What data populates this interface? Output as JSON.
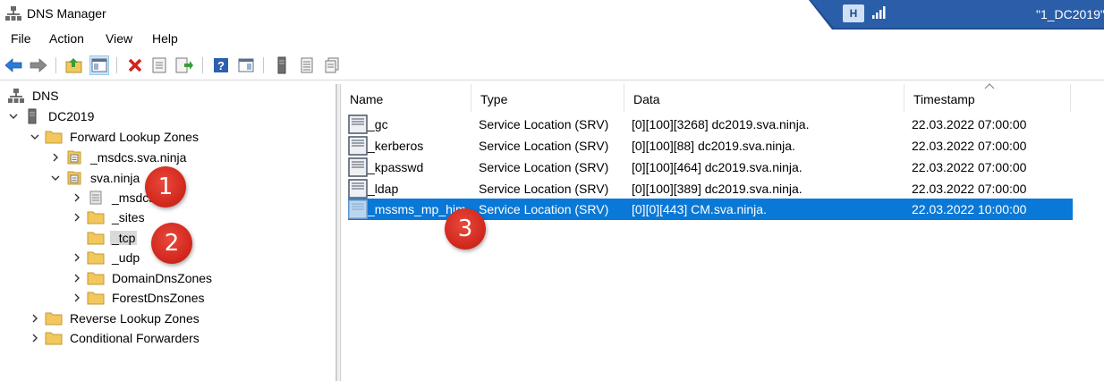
{
  "window": {
    "title": "DNS Manager",
    "remote_session_title": "\"1_DC2019\""
  },
  "menu": [
    "File",
    "Action",
    "View",
    "Help"
  ],
  "toolbar": {
    "buttons": [
      "back-arrow-icon",
      "forward-arrow-icon",
      "up-folder-icon",
      "show-tree-icon",
      "delete-icon",
      "properties-icon",
      "export-icon",
      "help-icon",
      "console-icon",
      "server-icon",
      "list-icon",
      "copy-icon"
    ]
  },
  "tree": {
    "root": "DNS",
    "server": "DC2019",
    "forward_zones": "Forward Lookup Zones",
    "msdcs_zone": "_msdcs.sva.ninja",
    "sva_zone": "sva.ninja",
    "msdcs_sub": "_msdcs",
    "sites": "_sites",
    "tcp": "_tcp",
    "udp": "_udp",
    "domain_dns_zones": "DomainDnsZones",
    "forest_dns_zones": "ForestDnsZones",
    "reverse_zones": "Reverse Lookup Zones",
    "conditional_forwarders": "Conditional Forwarders"
  },
  "list": {
    "columns": [
      "Name",
      "Type",
      "Data",
      "Timestamp"
    ],
    "rows": [
      {
        "name": "_gc",
        "type": "Service Location (SRV)",
        "data": "[0][100][3268] dc2019.sva.ninja.",
        "timestamp": "22.03.2022 07:00:00"
      },
      {
        "name": "_kerberos",
        "type": "Service Location (SRV)",
        "data": "[0][100][88] dc2019.sva.ninja.",
        "timestamp": "22.03.2022 07:00:00"
      },
      {
        "name": "_kpasswd",
        "type": "Service Location (SRV)",
        "data": "[0][100][464] dc2019.sva.ninja.",
        "timestamp": "22.03.2022 07:00:00"
      },
      {
        "name": "_ldap",
        "type": "Service Location (SRV)",
        "data": "[0][100][389] dc2019.sva.ninja.",
        "timestamp": "22.03.2022 07:00:00"
      },
      {
        "name": "_mssms_mp_him",
        "type": "Service Location (SRV)",
        "data": "[0][0][443] CM.sva.ninja.",
        "timestamp": "22.03.2022 10:00:00"
      }
    ]
  },
  "callouts": [
    "1",
    "2",
    "3"
  ],
  "colors": {
    "selection": "#0a78d7",
    "callout": "#d42a1f",
    "folder": "#f2c75c",
    "remote_bar": "#1f4d8f"
  }
}
